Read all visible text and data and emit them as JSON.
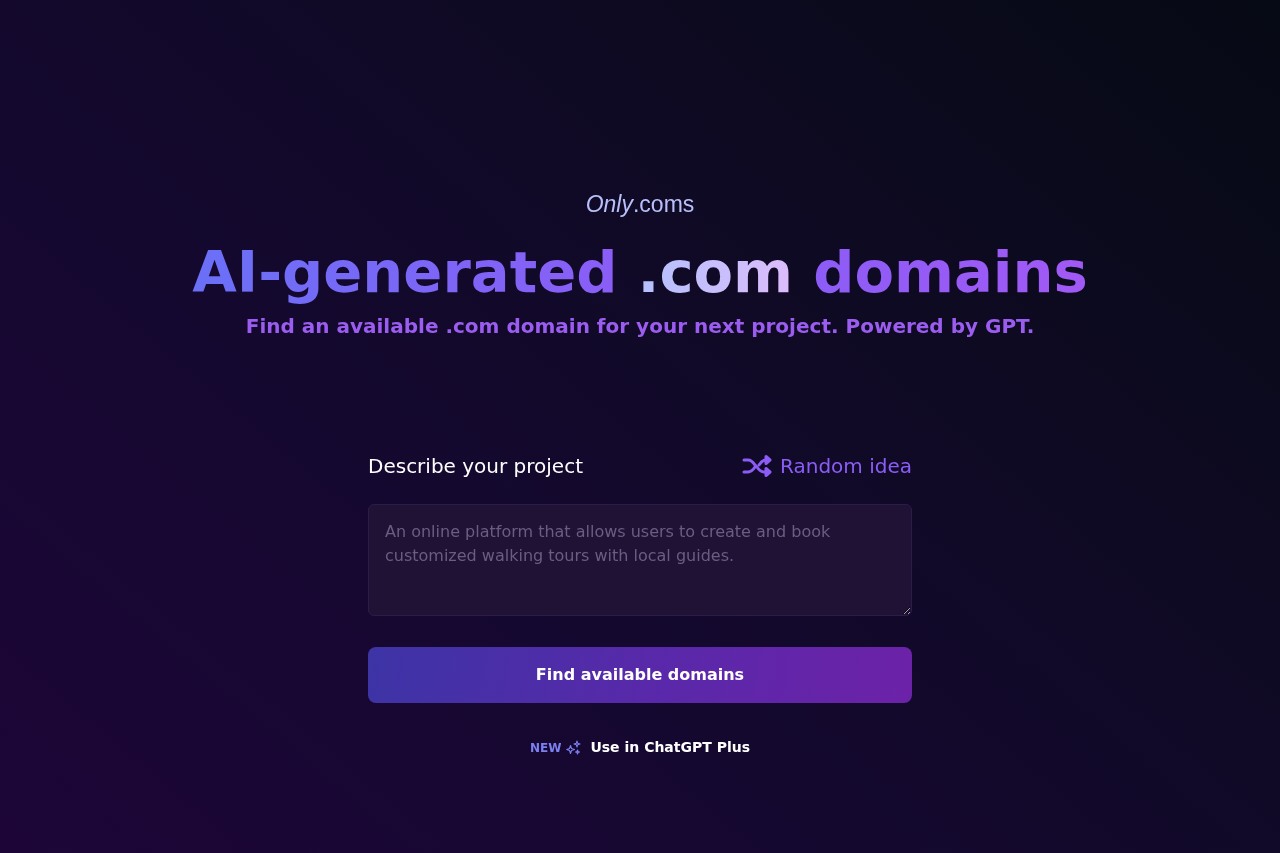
{
  "logo": "*Only*.coms",
  "heading": "AI-generated .com domains",
  "subheading": "Find an available .com domain for your next project. Powered by GPT.",
  "form": {
    "label": "Describe your project",
    "random_button": "Random idea",
    "textarea": {
      "placeholder": "An online platform that allows users to create and book customized walking tours with local guides."
    },
    "submit_button": "Find available domains"
  },
  "promo": {
    "badge": "NEW",
    "link": "Use in ChatGPT Plus"
  }
}
